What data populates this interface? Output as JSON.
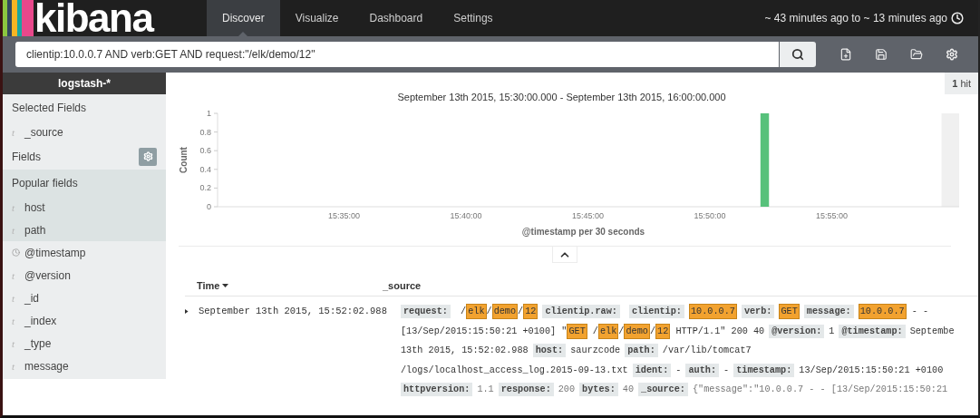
{
  "logo": {
    "text": "kibana"
  },
  "nav": [
    {
      "label": "Discover",
      "selected": true
    },
    {
      "label": "Visualize",
      "selected": false
    },
    {
      "label": "Dashboard",
      "selected": false
    },
    {
      "label": "Settings",
      "selected": false
    }
  ],
  "time_range": "~ 43 minutes ago to ~ 13 minutes ago",
  "query": {
    "value": "clientip:10.0.0.7 AND verb:GET AND request:\"/elk/demo/12\""
  },
  "sidebar": {
    "index_pattern": "logstash-*",
    "selected_fields_title": "Selected Fields",
    "selected_fields": [
      {
        "name": "_source",
        "kind": "string",
        "icon": "t"
      }
    ],
    "fields_title": "Fields",
    "popular_title": "Popular fields",
    "popular_fields": [
      {
        "name": "host",
        "kind": "string",
        "icon": "t"
      },
      {
        "name": "path",
        "kind": "string",
        "icon": "t"
      }
    ],
    "fields": [
      {
        "name": "@timestamp",
        "kind": "date"
      },
      {
        "name": "@version",
        "kind": "string",
        "icon": "t"
      },
      {
        "name": "_id",
        "kind": "string",
        "icon": "t"
      },
      {
        "name": "_index",
        "kind": "string",
        "icon": "t"
      },
      {
        "name": "_type",
        "kind": "string",
        "icon": "t"
      },
      {
        "name": "message",
        "kind": "string",
        "icon": "t"
      }
    ]
  },
  "hits": {
    "count": "1",
    "label": "hit"
  },
  "histogram": {
    "chart_data": {
      "type": "bar",
      "title": "September 13th 2015, 15:30:00.000 - September 13th 2015, 16:00:00.000",
      "xlabel": "@timestamp per 30 seconds",
      "ylabel": "Count",
      "categories": [
        null,
        null,
        null,
        null,
        null,
        null,
        null,
        null,
        null,
        null,
        "15:35:00",
        null,
        null,
        null,
        null,
        null,
        null,
        null,
        null,
        null,
        "15:40:00",
        null,
        null,
        null,
        null,
        null,
        null,
        null,
        null,
        null,
        "15:45:00",
        null,
        null,
        null,
        null,
        null,
        null,
        null,
        null,
        null,
        "15:50:00",
        null,
        null,
        null,
        null,
        null,
        null,
        null,
        null,
        null,
        "15:55:00",
        null,
        null,
        null,
        null,
        null,
        null,
        null,
        null,
        null
      ],
      "values": [
        0,
        0,
        0,
        0,
        0,
        0,
        0,
        0,
        0,
        0,
        0,
        0,
        0,
        0,
        0,
        0,
        0,
        0,
        0,
        0,
        0,
        0,
        0,
        0,
        0,
        0,
        0,
        0,
        0,
        0,
        0,
        0,
        0,
        0,
        0,
        0,
        0,
        0,
        0,
        0,
        0,
        0,
        0,
        0,
        1,
        0,
        0,
        0,
        0,
        0,
        0,
        0,
        0,
        0,
        0,
        0,
        0,
        0,
        0,
        0
      ],
      "ylim": [
        0,
        1
      ],
      "yticks": [
        0,
        0.2,
        0.4,
        0.6,
        0.8,
        1
      ]
    }
  },
  "table": {
    "columns": [
      {
        "label": "Time",
        "sorted": true
      },
      {
        "label": "_source",
        "sorted": false
      }
    ],
    "rows": [
      {
        "expanded": false,
        "time": "September 13th 2015, 15:52:02.988",
        "truncated": true,
        "lines": [
          [
            {
              "kind": "key",
              "text": "request:"
            },
            {
              "kind": "text",
              "text": " /"
            },
            {
              "kind": "hit",
              "text": "elk"
            },
            {
              "kind": "text",
              "text": "/"
            },
            {
              "kind": "hit",
              "text": "demo"
            },
            {
              "kind": "text",
              "text": "/"
            },
            {
              "kind": "hit",
              "text": "12"
            },
            {
              "kind": "key",
              "text": "clientip.raw:"
            },
            {
              "kind": "key",
              "text": "clientip:"
            },
            {
              "kind": "hit",
              "text": "10.0.0.7"
            },
            {
              "kind": "key",
              "text": "verb:"
            },
            {
              "kind": "hit",
              "text": "GET"
            },
            {
              "kind": "key",
              "text": "message:"
            },
            {
              "kind": "hit",
              "text": "10.0.0.7"
            },
            {
              "kind": "text",
              "text": " - -"
            }
          ],
          [
            {
              "kind": "text",
              "text": "[13/Sep/2015:15:50:21 +0100] \""
            },
            {
              "kind": "hit",
              "text": "GET"
            },
            {
              "kind": "text",
              "text": " /"
            },
            {
              "kind": "hit",
              "text": "elk"
            },
            {
              "kind": "text",
              "text": "/"
            },
            {
              "kind": "hit",
              "text": "demo"
            },
            {
              "kind": "text",
              "text": "/"
            },
            {
              "kind": "hit",
              "text": "12"
            },
            {
              "kind": "text",
              "text": " HTTP/1.1\" 200 40"
            },
            {
              "kind": "key",
              "text": "@version:"
            },
            {
              "kind": "text",
              "text": "1"
            },
            {
              "kind": "key",
              "text": "@timestamp:"
            },
            {
              "kind": "text",
              "text": "Septembe"
            }
          ],
          [
            {
              "kind": "text",
              "text": "13th 2015, 15:52:02.988"
            },
            {
              "kind": "key",
              "text": "host:"
            },
            {
              "kind": "text",
              "text": "saurzcode"
            },
            {
              "kind": "key",
              "text": "path:"
            },
            {
              "kind": "text",
              "text": "/var/lib/tomcat7"
            }
          ],
          [
            {
              "kind": "text",
              "text": "/logs/localhost_access_log.2015-09-13.txt"
            },
            {
              "kind": "key",
              "text": "ident:"
            },
            {
              "kind": "text",
              "text": "-"
            },
            {
              "kind": "key",
              "text": "auth:"
            },
            {
              "kind": "text",
              "text": "-"
            },
            {
              "kind": "key",
              "text": "timestamp:"
            },
            {
              "kind": "text",
              "text": "13/Sep/2015:15:50:21 +0100"
            }
          ],
          [
            {
              "kind": "key",
              "text": "httpversion:"
            },
            {
              "kind": "text",
              "text": "1.1"
            },
            {
              "kind": "key",
              "text": "response:"
            },
            {
              "kind": "text",
              "text": "200"
            },
            {
              "kind": "key",
              "text": "bytes:"
            },
            {
              "kind": "text",
              "text": "40"
            },
            {
              "kind": "key",
              "text": "_source:"
            },
            {
              "kind": "text",
              "text": "{\"message\":\"10.0.0.7 - - [13/Sep/2015:15:50:21"
            }
          ]
        ]
      }
    ]
  }
}
